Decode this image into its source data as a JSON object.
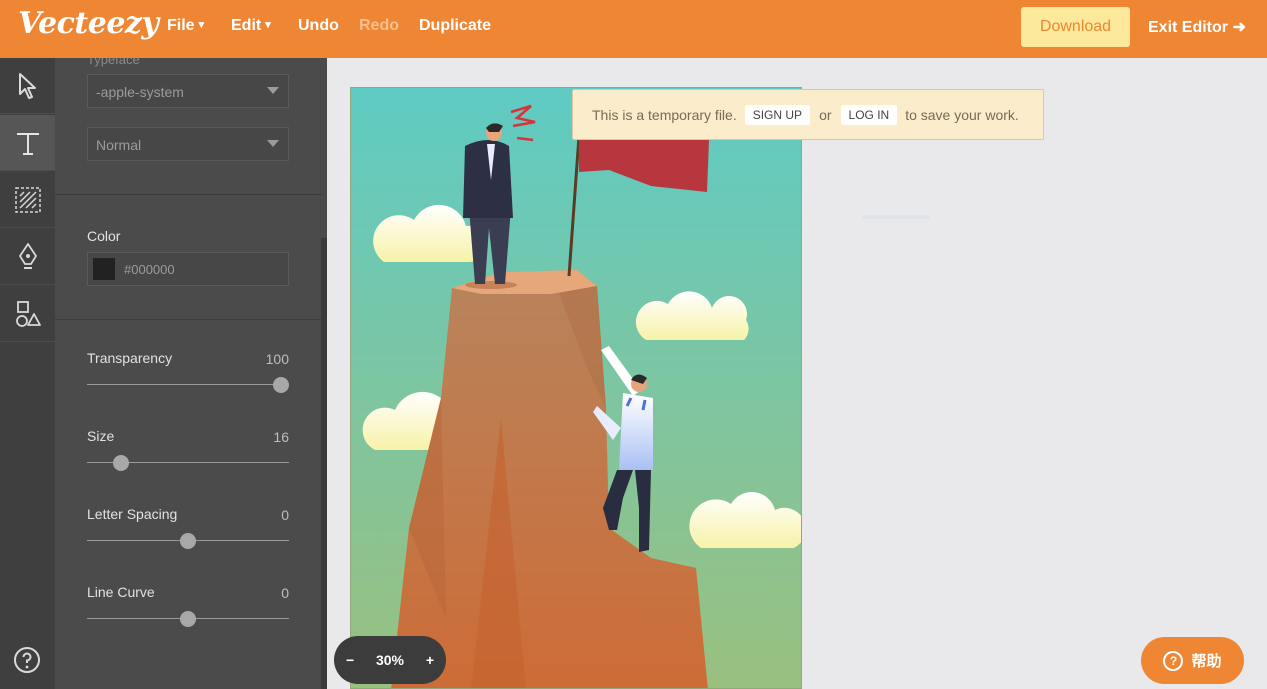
{
  "header": {
    "logo": "Vecteezy",
    "menu": [
      {
        "label": "File",
        "caret": "▾"
      },
      {
        "label": "Edit",
        "caret": "▾"
      },
      {
        "label": "Undo"
      },
      {
        "label": "Redo"
      },
      {
        "label": "Duplicate"
      }
    ],
    "download_label": "Download",
    "exit_label": "Exit Editor ➜"
  },
  "tools": [
    {
      "name": "select-tool",
      "icon": "pointer-icon"
    },
    {
      "name": "text-tool",
      "icon": "text-icon",
      "active": true
    },
    {
      "name": "pattern-tool",
      "icon": "hatch-icon"
    },
    {
      "name": "pen-tool",
      "icon": "pen-nib-icon"
    },
    {
      "name": "shapes-tool",
      "icon": "shapes-icon"
    }
  ],
  "panel": {
    "typeface_label_cut": "Typeface",
    "font_family": "-apple-system",
    "font_weight": "Normal",
    "color_label": "Color",
    "color_value": "#000000",
    "sliders": [
      {
        "label": "Transparency",
        "value": "100",
        "fraction": 1.0
      },
      {
        "label": "Size",
        "value": "16",
        "fraction": 0.14
      },
      {
        "label": "Letter Spacing",
        "value": "0",
        "fraction": 0.5
      },
      {
        "label": "Line Curve",
        "value": "0",
        "fraction": 0.5
      }
    ]
  },
  "banner": {
    "text_before": "This is a temporary file.",
    "sign_up": "SIGN UP",
    "or": "or",
    "log_in": "LOG IN",
    "text_after": "to save your work."
  },
  "zoom": {
    "minus": "−",
    "value": "30%",
    "plus": "+"
  },
  "help": {
    "label": "帮助",
    "icon": "?"
  },
  "colors": {
    "brand": "#ef8634",
    "download_bg": "#fde99b",
    "panel": "#4b4b4b",
    "rail": "#3f3f3f"
  }
}
